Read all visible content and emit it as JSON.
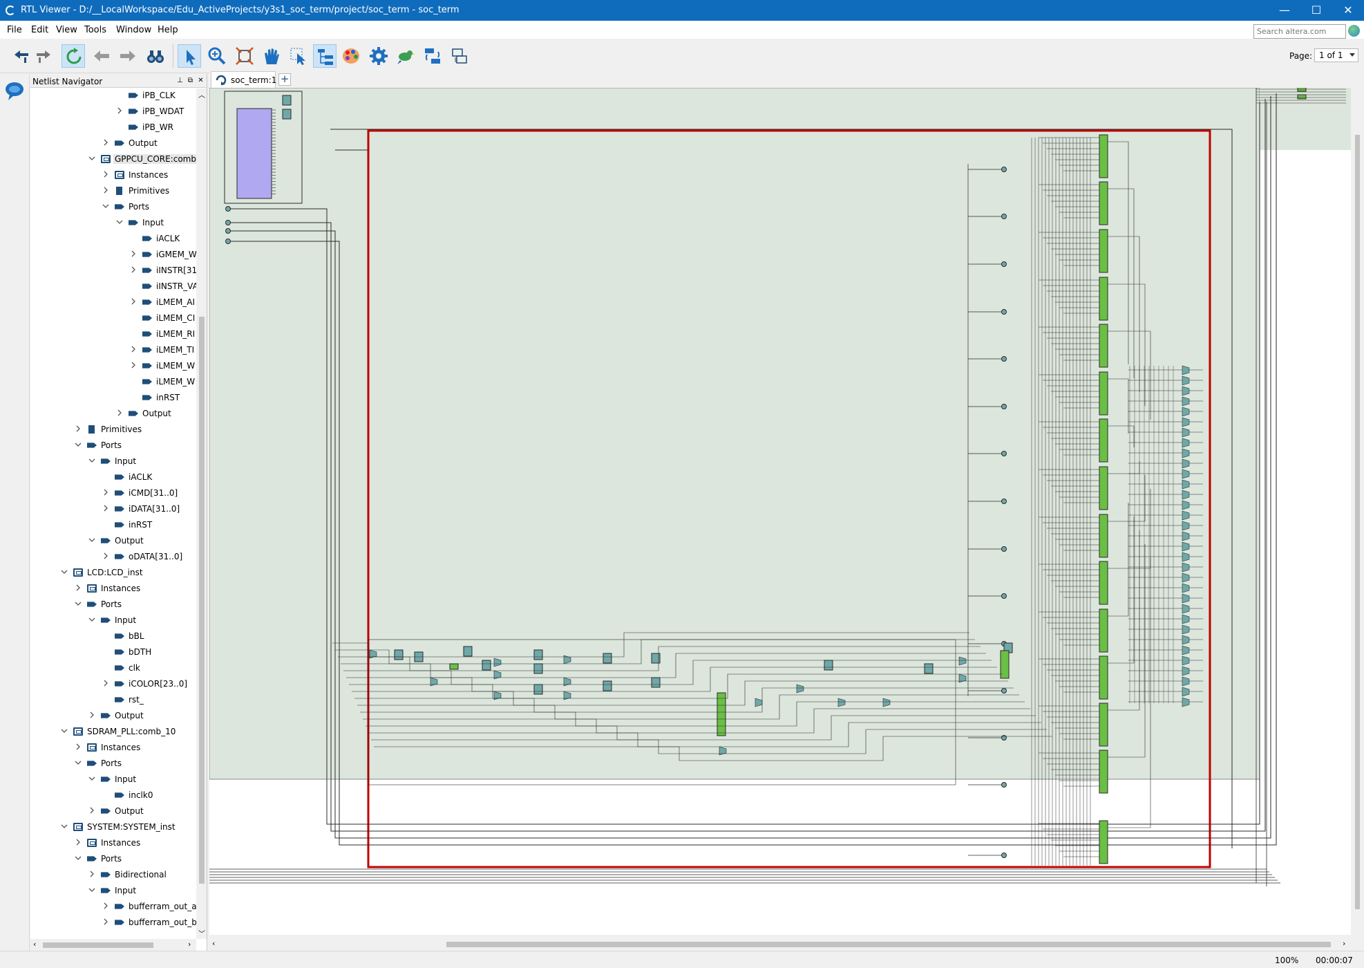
{
  "window": {
    "title": "RTL Viewer - D:/__LocalWorkspace/Edu_ActiveProjects/y3s1_soc_term/project/soc_term - soc_term",
    "minimize": "—",
    "maximize": "☐",
    "close": "✕"
  },
  "menu": [
    {
      "label": "File"
    },
    {
      "label": "Edit"
    },
    {
      "label": "View"
    },
    {
      "label": "Tools"
    },
    {
      "label": "Window"
    },
    {
      "label": "Help"
    }
  ],
  "search": {
    "placeholder": "Search altera.com"
  },
  "toolbar": {
    "buttons": [
      "back-history-icon",
      "forward-history-icon",
      "refresh-icon",
      "back-icon",
      "forward-icon",
      "binoculars-icon",
      "select-arrow-icon",
      "zoom-icon",
      "fit-window-icon",
      "hand-icon",
      "area-select-icon",
      "hierarchy-icon",
      "color-palette-icon",
      "gear-icon",
      "bird-icon",
      "netlist-update-icon",
      "export-icon"
    ],
    "page_label": "Page:",
    "page_value": "1 of 1"
  },
  "navigator": {
    "title": "Netlist Navigator",
    "items": [
      {
        "label": "iPB_CLK",
        "icon": "port"
      },
      {
        "label": "iPB_WDAT",
        "icon": "port"
      },
      {
        "label": "iPB_WR",
        "icon": "port"
      },
      {
        "label": "Output",
        "icon": "port"
      },
      {
        "label": "GPPCU_CORE:comb_",
        "icon": "instance"
      },
      {
        "label": "Instances",
        "icon": "instance"
      },
      {
        "label": "Primitives",
        "icon": "primitive"
      },
      {
        "label": "Ports",
        "icon": "port"
      },
      {
        "label": "Input",
        "icon": "port"
      },
      {
        "label": "iACLK",
        "icon": "port"
      },
      {
        "label": "iGMEM_W",
        "icon": "port"
      },
      {
        "label": "iINSTR[31",
        "icon": "port"
      },
      {
        "label": "iINSTR_VA",
        "icon": "port"
      },
      {
        "label": "iLMEM_AI",
        "icon": "port"
      },
      {
        "label": "iLMEM_CI",
        "icon": "port"
      },
      {
        "label": "iLMEM_RI",
        "icon": "port"
      },
      {
        "label": "iLMEM_TI",
        "icon": "port"
      },
      {
        "label": "iLMEM_W",
        "icon": "port"
      },
      {
        "label": "iLMEM_W",
        "icon": "port"
      },
      {
        "label": "inRST",
        "icon": "port"
      },
      {
        "label": "Output",
        "icon": "port"
      },
      {
        "label": "Primitives",
        "icon": "primitive"
      },
      {
        "label": "Ports",
        "icon": "port"
      },
      {
        "label": "Input",
        "icon": "port"
      },
      {
        "label": "iACLK",
        "icon": "port"
      },
      {
        "label": "iCMD[31..0]",
        "icon": "port"
      },
      {
        "label": "iDATA[31..0]",
        "icon": "port"
      },
      {
        "label": "inRST",
        "icon": "port"
      },
      {
        "label": "Output",
        "icon": "port"
      },
      {
        "label": "oDATA[31..0]",
        "icon": "port"
      },
      {
        "label": "LCD:LCD_inst",
        "icon": "instance"
      },
      {
        "label": "Instances",
        "icon": "instance"
      },
      {
        "label": "Ports",
        "icon": "port"
      },
      {
        "label": "Input",
        "icon": "port"
      },
      {
        "label": "bBL",
        "icon": "port"
      },
      {
        "label": "bDTH",
        "icon": "port"
      },
      {
        "label": "clk",
        "icon": "port"
      },
      {
        "label": "iCOLOR[23..0]",
        "icon": "port"
      },
      {
        "label": "rst_",
        "icon": "port"
      },
      {
        "label": "Output",
        "icon": "port"
      },
      {
        "label": "SDRAM_PLL:comb_10",
        "icon": "instance"
      },
      {
        "label": "Instances",
        "icon": "instance"
      },
      {
        "label": "Ports",
        "icon": "port"
      },
      {
        "label": "Input",
        "icon": "port"
      },
      {
        "label": "inclk0",
        "icon": "port"
      },
      {
        "label": "Output",
        "icon": "port"
      },
      {
        "label": "SYSTEM:SYSTEM_inst",
        "icon": "instance"
      },
      {
        "label": "Instances",
        "icon": "instance"
      },
      {
        "label": "Ports",
        "icon": "port"
      },
      {
        "label": "Bidirectional",
        "icon": "port"
      },
      {
        "label": "Input",
        "icon": "port"
      },
      {
        "label": "bufferram_out_ac",
        "icon": "port"
      },
      {
        "label": "bufferram_out_b",
        "icon": "port"
      }
    ]
  },
  "document_tab": {
    "label": "soc_term:1",
    "add": "+"
  },
  "status": {
    "zoom": "100%",
    "elapsed": "00:00:07"
  },
  "colors": {
    "titlebar": "#0f6cbd",
    "schematic_bg": "#dce6dc",
    "selection_frame": "#c00000",
    "register": "#6fa8a8",
    "memory_block": "#6abf45",
    "purple_block": "#b0a8f0"
  }
}
